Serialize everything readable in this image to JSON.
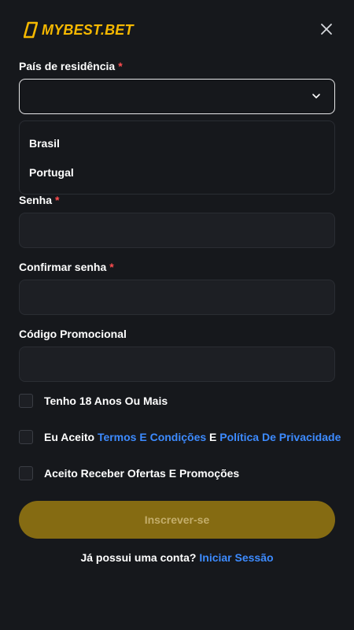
{
  "header": {
    "logo_text": "MYBEST.BET",
    "brand_color": "#f5b800",
    "close_icon": "close-icon"
  },
  "form": {
    "country": {
      "label": "País de residência",
      "required_mark": "*",
      "value": "",
      "options": [
        "Brasil",
        "Portugal"
      ]
    },
    "password": {
      "label": "Senha",
      "required_mark": "*",
      "value": ""
    },
    "confirm_password": {
      "label": "Confirmar senha",
      "required_mark": "*",
      "value": ""
    },
    "promo_code": {
      "label": "Código Promocional",
      "value": ""
    },
    "checkboxes": {
      "age": {
        "label": "Tenho 18 Anos Ou Mais",
        "checked": false
      },
      "terms": {
        "prefix": "Eu Aceito",
        "terms_link": "Termos E Condições",
        "connector": "E",
        "privacy_link": "Política De Privacidade",
        "checked": false
      },
      "offers": {
        "label": "Aceito Receber Ofertas E Promoções",
        "checked": false
      }
    },
    "submit_label": "Inscrever-se"
  },
  "footer": {
    "question": "Já possui uma conta?",
    "login_link": "Iniciar Sessão"
  },
  "colors": {
    "background": "#16181c",
    "field": "#1d1f24",
    "accent_link": "#3d8bff",
    "required": "#ff4d4f",
    "submit_bg": "#856b12"
  }
}
